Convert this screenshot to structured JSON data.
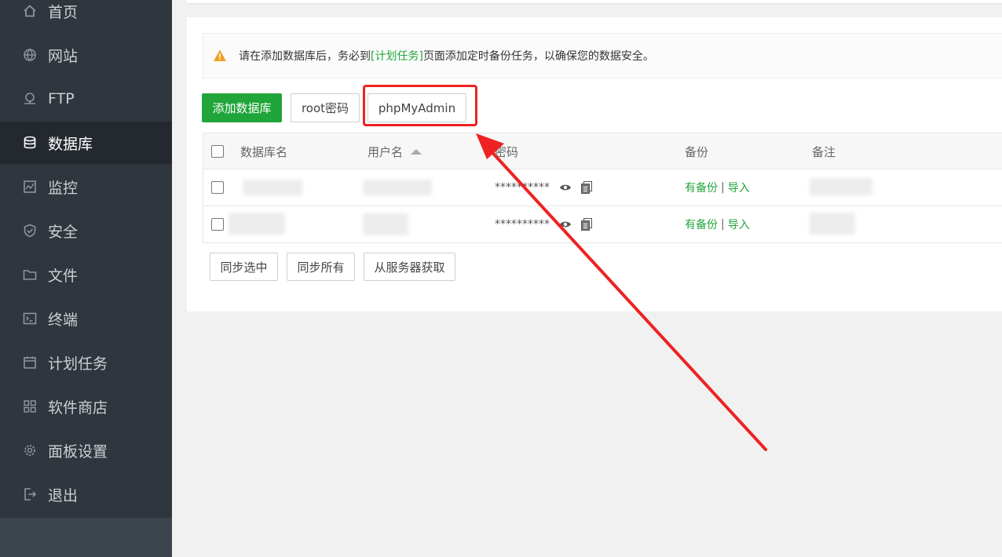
{
  "sidebar": {
    "items": [
      {
        "label": "首页",
        "icon": "home-icon"
      },
      {
        "label": "网站",
        "icon": "globe-icon"
      },
      {
        "label": "FTP",
        "icon": "ftp-icon"
      },
      {
        "label": "数据库",
        "icon": "database-icon",
        "active": true
      },
      {
        "label": "监控",
        "icon": "monitor-icon"
      },
      {
        "label": "安全",
        "icon": "shield-icon"
      },
      {
        "label": "文件",
        "icon": "folder-icon"
      },
      {
        "label": "终端",
        "icon": "terminal-icon"
      },
      {
        "label": "计划任务",
        "icon": "calendar-icon"
      },
      {
        "label": "软件商店",
        "icon": "apps-icon"
      },
      {
        "label": "面板设置",
        "icon": "gear-icon"
      },
      {
        "label": "退出",
        "icon": "logout-icon"
      }
    ]
  },
  "notice": {
    "prefix": "请在添加数据库后，务必到",
    "link": "[计划任务]",
    "suffix": "页面添加定时备份任务，以确保您的数据安全。"
  },
  "toolbar": {
    "add_label": "添加数据库",
    "root_label": "root密码",
    "pma_label": "phpMyAdmin"
  },
  "table": {
    "columns": {
      "name": "数据库名",
      "user": "用户名",
      "password": "密码",
      "backup": "备份",
      "note": "备注"
    },
    "rows": [
      {
        "password": "**********",
        "backup": "有备份",
        "import": "导入",
        "sep": "|"
      },
      {
        "password": "**********",
        "backup": "有备份",
        "import": "导入",
        "sep": "|"
      }
    ]
  },
  "footer_buttons": {
    "sync_selected": "同步选中",
    "sync_all": "同步所有",
    "fetch_server": "从服务器获取"
  },
  "colors": {
    "accent": "#20a53a",
    "sidebar_bg": "#2f363e",
    "annotation": "#ee2222"
  }
}
